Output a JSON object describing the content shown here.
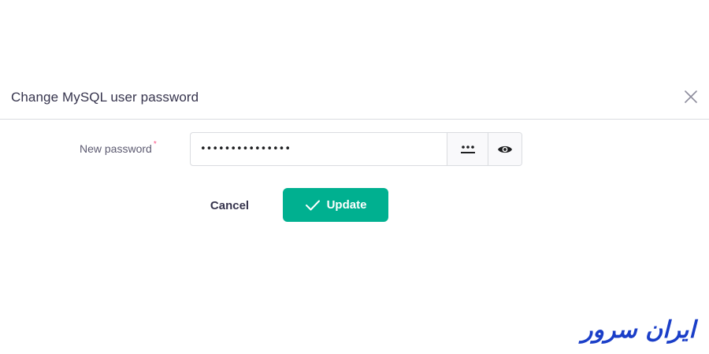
{
  "dialog": {
    "title": "Change MySQL user password",
    "close_icon": "close-icon"
  },
  "form": {
    "label": "New password",
    "required_mark": "*",
    "password_value": "•••••••••••••••",
    "generate_icon": "dots-password-icon",
    "toggle_visibility_icon": "eye-icon"
  },
  "actions": {
    "cancel_label": "Cancel",
    "update_label": "Update",
    "update_icon": "check-icon",
    "accent_color": "#00b090"
  },
  "brand": {
    "logo_text": "ایران سرور",
    "color": "#1a3ec8"
  }
}
